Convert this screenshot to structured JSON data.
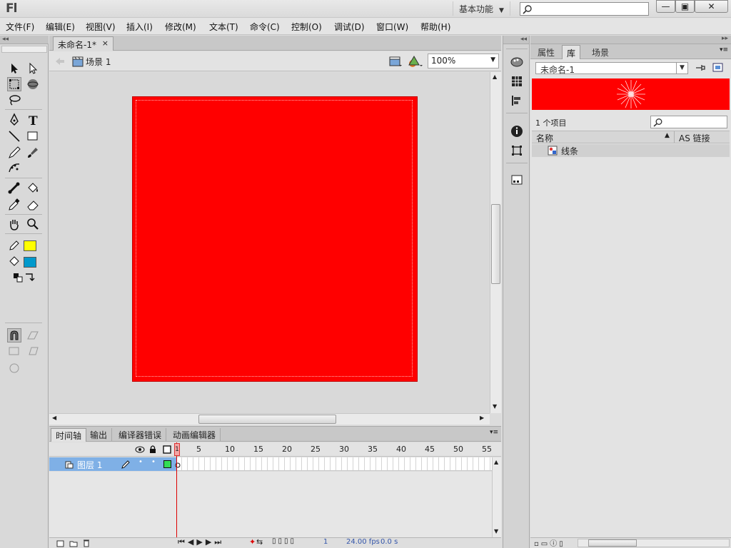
{
  "app": {
    "logo": "Fl",
    "workspace": "基本功能",
    "window_buttons": {
      "minimize": "—",
      "maximize": "▣",
      "close": "✕"
    }
  },
  "menu": [
    "文件(F)",
    "编辑(E)",
    "视图(V)",
    "插入(I)",
    "修改(M)",
    "文本(T)",
    "命令(C)",
    "控制(O)",
    "调试(D)",
    "窗口(W)",
    "帮助(H)"
  ],
  "document": {
    "tab_title": "未命名-1*",
    "tab_close": "×",
    "scene_label": "场景 1",
    "zoom": "100%",
    "stage_color": "#ff0000"
  },
  "timeline": {
    "tabs": [
      "时间轴",
      "输出",
      "编译器错误",
      "动画编辑器"
    ],
    "frame_numbers": [
      "1",
      "5",
      "10",
      "15",
      "20",
      "25",
      "30",
      "35",
      "40",
      "45",
      "50",
      "55"
    ],
    "current_frame_marker": "1",
    "layer_name": "图层 1",
    "footer": {
      "frame": "1",
      "fps": "24.00 fps",
      "time": "0.0 s"
    }
  },
  "tools": {
    "stroke_color": "#ffff00",
    "fill_color": "#0099cc"
  },
  "library": {
    "tabs": [
      "属性",
      "库",
      "场景"
    ],
    "active_tab": "库",
    "document_select": "未命名-1",
    "item_count": "1 个项目",
    "columns": {
      "name": "名称",
      "linkage": "AS 链接"
    },
    "items": [
      {
        "name": "线条"
      }
    ]
  },
  "colors": {
    "selection_blue": "#7fb0e6",
    "playhead_red": "#dd0000"
  }
}
